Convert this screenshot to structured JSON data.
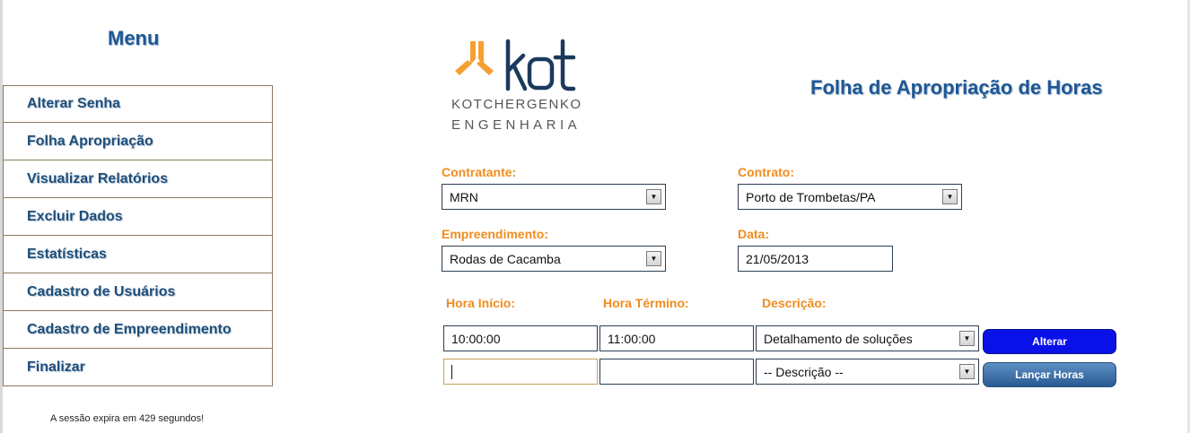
{
  "menu": {
    "title": "Menu",
    "items": [
      {
        "label": "Alterar Senha"
      },
      {
        "label": "Folha Apropriação"
      },
      {
        "label": "Visualizar Relatórios"
      },
      {
        "label": "Excluir Dados"
      },
      {
        "label": "Estatísticas"
      },
      {
        "label": "Cadastro de Usuários"
      },
      {
        "label": "Cadastro de Empreendimento"
      },
      {
        "label": "Finalizar"
      }
    ],
    "session_text": "A sessão expira em 429 segundos!"
  },
  "logo": {
    "brand": "kot",
    "line1": "KOTCHERGENKO",
    "line2": "ENGENHARIA",
    "colors": {
      "orange": "#f4a033",
      "navy": "#1b3a5c"
    }
  },
  "page_title": "Folha de Apropriação de Horas",
  "form": {
    "contratante": {
      "label": "Contratante:",
      "value": "MRN"
    },
    "contrato": {
      "label": "Contrato:",
      "value": "Porto de Trombetas/PA"
    },
    "empreendimento": {
      "label": "Empreendimento:",
      "value": "Rodas de Cacamba"
    },
    "data": {
      "label": "Data:",
      "value": "21/05/2013"
    },
    "columns": {
      "hora_inicio": "Hora Início:",
      "hora_termino": "Hora Término:",
      "descricao": "Descrição:"
    },
    "rows": [
      {
        "hora_inicio": "10:00:00",
        "hora_termino": "11:00:00",
        "descricao": "Detalhamento de soluções",
        "button": "Alterar"
      },
      {
        "hora_inicio": "",
        "hora_termino": "",
        "descricao": "-- Descrição --",
        "button": "Lançar Horas"
      }
    ]
  },
  "colors": {
    "accent_blue": "#1f5794",
    "label_orange": "#f08c1e",
    "button_blue": "#0a10e8"
  }
}
